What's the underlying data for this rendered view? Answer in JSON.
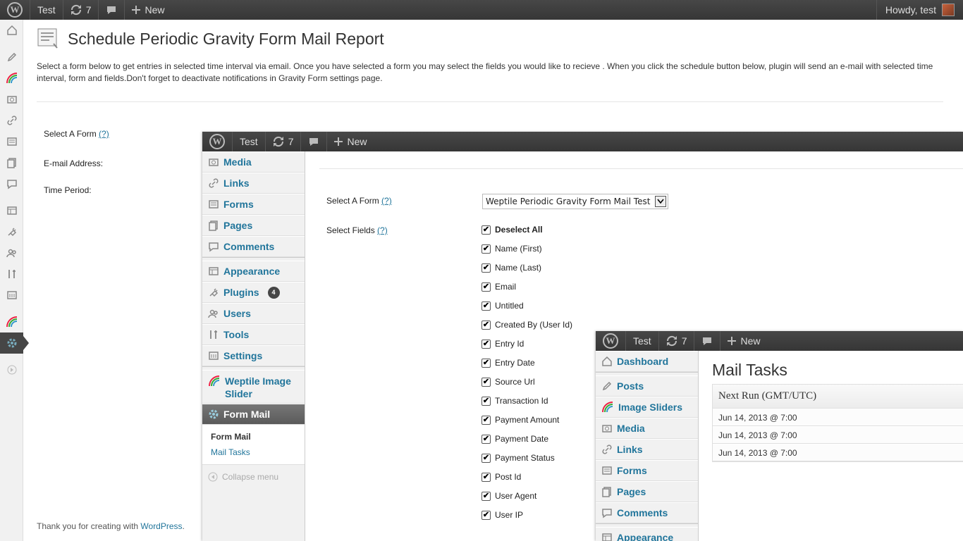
{
  "admin_bar": {
    "site": "Test",
    "updates": "7",
    "new": "New",
    "howdy": "Howdy, test"
  },
  "page": {
    "title": "Schedule Periodic Gravity Form Mail Report",
    "description": "Select a form below to get entries in selected time interval via email. Once you have selected a form you may select the fields you would like to recieve . When you click the schedule button below, plugin will send an e-mail with selected time interval, form and fields.Don't forget to deactivate notifications in Gravity Form settings page.",
    "select_form_label": "Select A Form",
    "help_link": "(?)",
    "email_label": "E-mail Address:",
    "time_period_label": "Time Period:",
    "footer_text": "Thank you for creating with ",
    "footer_link": "WordPress",
    "footer_dot": "."
  },
  "window2": {
    "menu": {
      "media": "Media",
      "links": "Links",
      "forms": "Forms",
      "pages": "Pages",
      "comments": "Comments",
      "appearance": "Appearance",
      "plugins": "Plugins",
      "plugins_badge": "4",
      "users": "Users",
      "tools": "Tools",
      "settings": "Settings",
      "weptile": "Weptile Image Slider",
      "form_mail": "Form Mail",
      "sub_form_mail": "Form Mail",
      "sub_mail_tasks": "Mail Tasks",
      "collapse": "Collapse menu"
    },
    "select_form_label": "Select A Form",
    "select_fields_label": "Select Fields",
    "help_link": "(?)",
    "selected_form": "Weptile Periodic Gravity Form Mail Test",
    "fields": [
      "Deselect All",
      "Name (First)",
      "Name (Last)",
      "Email",
      "Untitled",
      "Created By (User Id)",
      "Entry Id",
      "Entry Date",
      "Source Url",
      "Transaction Id",
      "Payment Amount",
      "Payment Date",
      "Payment Status",
      "Post Id",
      "User Agent",
      "User IP"
    ]
  },
  "window3": {
    "menu": {
      "dashboard": "Dashboard",
      "posts": "Posts",
      "image_sliders": "Image Sliders",
      "media": "Media",
      "links": "Links",
      "forms": "Forms",
      "pages": "Pages",
      "comments": "Comments",
      "appearance": "Appearance"
    },
    "title": "Mail Tasks",
    "column_header": "Next Run (GMT/UTC)",
    "rows": [
      "Jun 14, 2013 @ 7:00",
      "Jun 14, 2013 @ 7:00",
      "Jun 14, 2013 @ 7:00"
    ]
  }
}
